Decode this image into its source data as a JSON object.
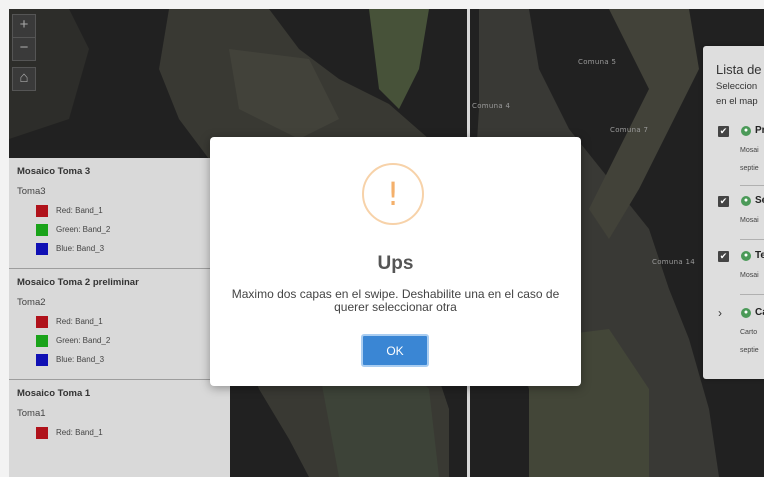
{
  "map": {
    "labels": {
      "comuna_5": "Comuna 5",
      "comuna_4": "Comuna 4",
      "comuna_7": "Comuna 7",
      "comuna_14": "Comuna 14"
    },
    "zoom_in": "+",
    "zoom_out": "−",
    "home_icon": "⌂"
  },
  "legend": {
    "blocks": [
      {
        "title": "Mosaico Toma 3",
        "layer": "Toma3",
        "bands": [
          "Red: Band_1",
          "Green: Band_2",
          "Blue: Band_3"
        ]
      },
      {
        "title": "Mosaico Toma 2 preliminar",
        "layer": "Toma2",
        "bands": [
          "Red: Band_1",
          "Green: Band_2",
          "Blue: Band_3"
        ]
      },
      {
        "title": "Mosaico Toma 1",
        "layer": "Toma1",
        "bands": [
          "Red: Band_1"
        ]
      }
    ],
    "colors": {
      "red": "#b0121b",
      "green": "#1aa31a",
      "blue": "#1010b4"
    }
  },
  "layer_panel": {
    "title": "Lista de",
    "subtitle_1": "Seleccion",
    "subtitle_2": "en el map",
    "items": [
      {
        "name": "Pr",
        "desc_1": "Mosai",
        "desc_2": "septie",
        "checked": "✔"
      },
      {
        "name": "Se",
        "desc_1": "Mosai",
        "checked": "✔"
      },
      {
        "name": "Te",
        "desc_1": "Mosai",
        "checked": "✔"
      },
      {
        "name": "Ca",
        "desc_1": "Carto",
        "desc_2": "septie",
        "caret": "›"
      }
    ]
  },
  "modal": {
    "icon": "!",
    "title": "Ups",
    "message": "Maximo dos capas en el swipe. Deshabilite una en el caso de querer seleccionar otra",
    "ok_label": "OK",
    "accent": "#3a86d4",
    "warning_color": "#f4b06b"
  }
}
